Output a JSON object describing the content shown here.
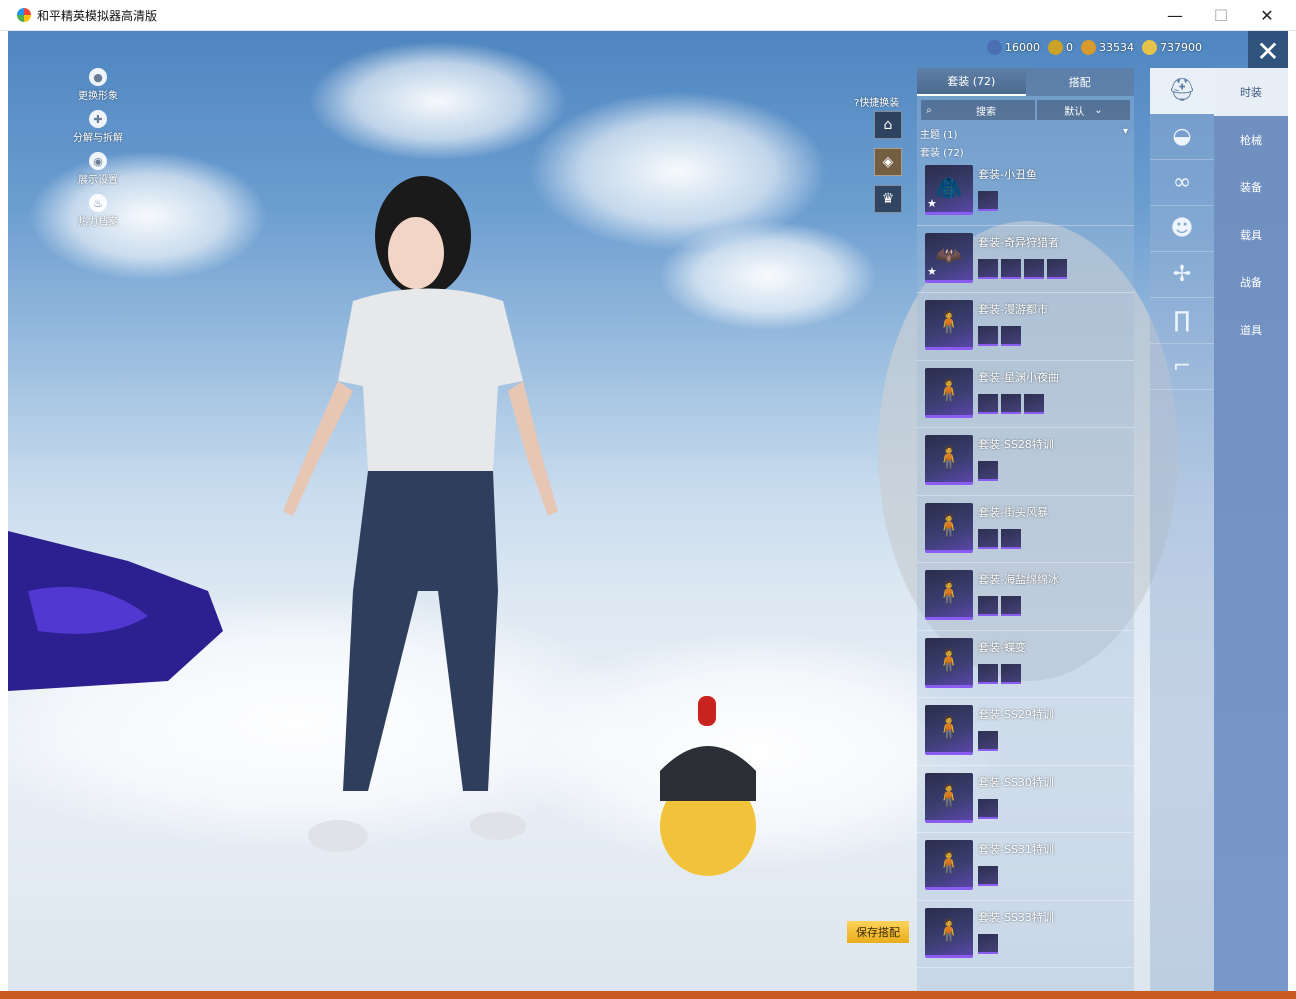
{
  "window": {
    "title": "和平精英模拟器高清版",
    "min": "—",
    "max": "☐",
    "close": "✕"
  },
  "left_menu": [
    {
      "label": "更换形象",
      "icon": "person-icon"
    },
    {
      "label": "分解与拆解",
      "icon": "dismantle-icon"
    },
    {
      "label": "展示设置",
      "icon": "eye-icon"
    },
    {
      "label": "热力档案",
      "icon": "flame-icon"
    }
  ],
  "currency": [
    {
      "value": "16000",
      "color": "#4a6fb5"
    },
    {
      "value": "0",
      "color": "#c9a227"
    },
    {
      "value": "33534",
      "color": "#d89a2a"
    },
    {
      "value": "737900",
      "color": "#e5c34a"
    }
  ],
  "quick_change": {
    "label": "快捷换装",
    "help": "?"
  },
  "panel": {
    "tabs": [
      {
        "label": "套装 (72)",
        "active": true
      },
      {
        "label": "搭配",
        "active": false
      }
    ],
    "search_label": "搜索",
    "sort_label": "默认",
    "filter_theme": "主题 (1)",
    "filter_set": "套装 (72)",
    "items": [
      {
        "name": "套装-小丑鱼",
        "thumb": "🧥",
        "star": true,
        "minis": 1
      },
      {
        "name": "套装-奇异狩猎者",
        "thumb": "🦇",
        "star": true,
        "minis": 4
      },
      {
        "name": "套装-漫游都市",
        "thumb": "🧍",
        "star": false,
        "minis": 2
      },
      {
        "name": "套装-星渊小夜曲",
        "thumb": "🧍",
        "star": false,
        "minis": 3
      },
      {
        "name": "套装-SS28特训",
        "thumb": "🧍",
        "star": false,
        "minis": 1
      },
      {
        "name": "套装-街头风暴",
        "thumb": "🧍",
        "star": false,
        "minis": 2
      },
      {
        "name": "套装-海盐绵绵冰",
        "thumb": "🧍",
        "star": false,
        "minis": 2
      },
      {
        "name": "套装-蝶变",
        "thumb": "🧍",
        "star": false,
        "minis": 2
      },
      {
        "name": "套装-SS29特训",
        "thumb": "🧍",
        "star": false,
        "minis": 1
      },
      {
        "name": "套装-SS30特训",
        "thumb": "🧍",
        "star": false,
        "minis": 1
      },
      {
        "name": "套装-SS31特训",
        "thumb": "🧍",
        "star": false,
        "minis": 1
      },
      {
        "name": "套装-SS33特训",
        "thumb": "🧍",
        "star": false,
        "minis": 1
      }
    ]
  },
  "save_button": "保存搭配",
  "category_icons": [
    "outfit-icon",
    "cap-icon",
    "glasses-icon",
    "mask-icon",
    "shirt-icon",
    "pants-icon",
    "shoes-icon"
  ],
  "side_tabs": [
    {
      "label": "时装",
      "active": true
    },
    {
      "label": "枪械",
      "active": false
    },
    {
      "label": "装备",
      "active": false
    },
    {
      "label": "载具",
      "active": false
    },
    {
      "label": "战备",
      "active": false
    },
    {
      "label": "道具",
      "active": false
    }
  ]
}
